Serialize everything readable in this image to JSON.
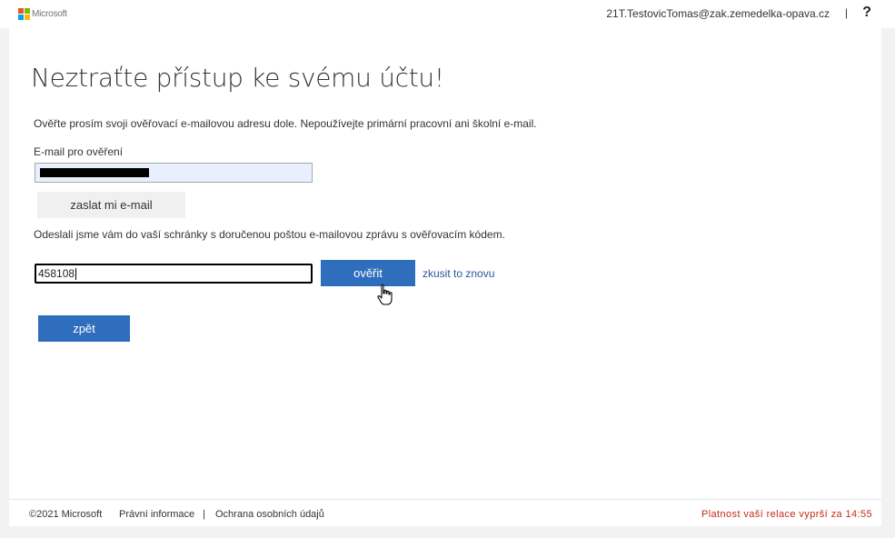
{
  "header": {
    "logo_text": "Microsoft",
    "user_email": "21T.TestovicTomas@zak.zemedelka-opava.cz",
    "separator": "|",
    "help": "?"
  },
  "main": {
    "title": "Neztraťte přístup ke svému účtu!",
    "instructions": "Ověřte prosím svoji ověřovací e-mailovou adresu dole. Nepoužívejte primární pracovní ani školní e-mail.",
    "email_label": "E-mail pro ověření",
    "send_button": "zaslat mi e-mail",
    "sent_message": "Odeslali jsme vám do vaší schránky s doručenou poštou e-mailovou zprávu s ověřovacím kódem.",
    "code_value": "458108",
    "verify_button": "ověřit",
    "retry_link": "zkusit to znovu",
    "back_button": "zpět"
  },
  "footer": {
    "copyright": "©2021 Microsoft",
    "legal_link": "Právní informace",
    "separator": "|",
    "privacy_link": "Ochrana osobních údajů",
    "session_timer": "Platnost vaší relace vyprší za 14:55"
  },
  "colors": {
    "accent": "#2f6ebd",
    "link": "#2b579a",
    "warning": "#c42b1c",
    "logo_red": "#f25022",
    "logo_green": "#7fba00",
    "logo_blue": "#00a4ef",
    "logo_yellow": "#ffb900"
  },
  "icons": {
    "cursor": "hand-pointer-icon"
  }
}
